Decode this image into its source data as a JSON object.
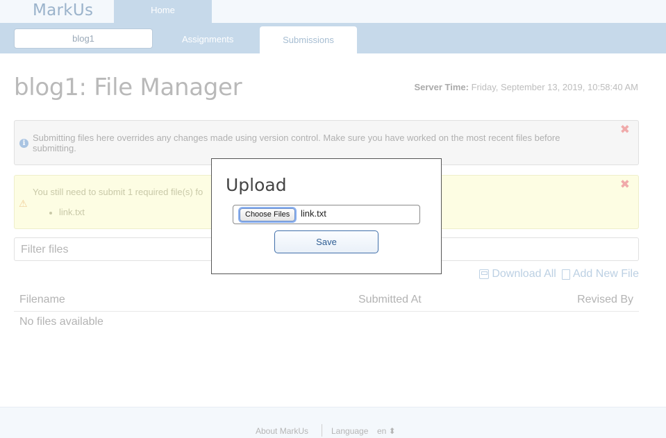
{
  "app": {
    "logo": "MarkUs"
  },
  "nav": {
    "home": "Home",
    "course": "blog1",
    "assignments": "Assignments",
    "submissions": "Submissions"
  },
  "page": {
    "title": "blog1: File Manager",
    "server_time_label": "Server Time:",
    "server_time_value": "Friday, September 13, 2019, 10:58:40 AM"
  },
  "notices": {
    "info": "Submitting files here overrides any changes made using version control. Make sure you have worked on the most recent files before submitting.",
    "warn_text": "You still need to submit 1 required file(s) fo",
    "warn_files": [
      "link.txt"
    ],
    "close": "✖"
  },
  "filter": {
    "placeholder": "Filter files"
  },
  "actions": {
    "download_all": "Download All",
    "add_new_file": "Add New File"
  },
  "table": {
    "columns": [
      "Filename",
      "Submitted At",
      "Revised By"
    ],
    "empty": "No files available"
  },
  "footer": {
    "about": "About MarkUs",
    "language_label": "Language",
    "language_value": "en ⬍"
  },
  "modal": {
    "title": "Upload",
    "choose_files": "Choose Files",
    "file_name": "link.txt",
    "save": "Save"
  }
}
